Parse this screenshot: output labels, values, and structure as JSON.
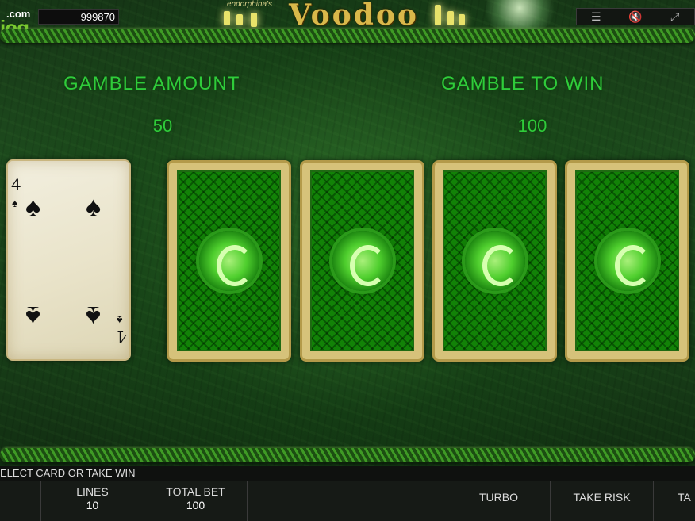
{
  "header": {
    "logo_com": ".com",
    "logo_main": "iog",
    "balance": "999870",
    "brand": "endorphina's",
    "game_title": "Voodoo",
    "controls": [
      "☰",
      "🔇",
      "⤢"
    ]
  },
  "gamble": {
    "amount_label": "GAMBLE AMOUNT",
    "amount_value": "50",
    "to_win_label": "GAMBLE TO WIN",
    "to_win_value": "100"
  },
  "dealer_card": {
    "rank": "4",
    "suit": "♠"
  },
  "closed_cards_count": 4,
  "status": {
    "message": "ELECT CARD OR TAKE WIN"
  },
  "bottom": {
    "lines_label": "LINES",
    "lines_value": "10",
    "total_bet_label": "TOTAL BET",
    "total_bet_value": "100",
    "turbo": "TURBO",
    "take_risk": "TAKE RISK",
    "take_win_partial": "TA"
  }
}
